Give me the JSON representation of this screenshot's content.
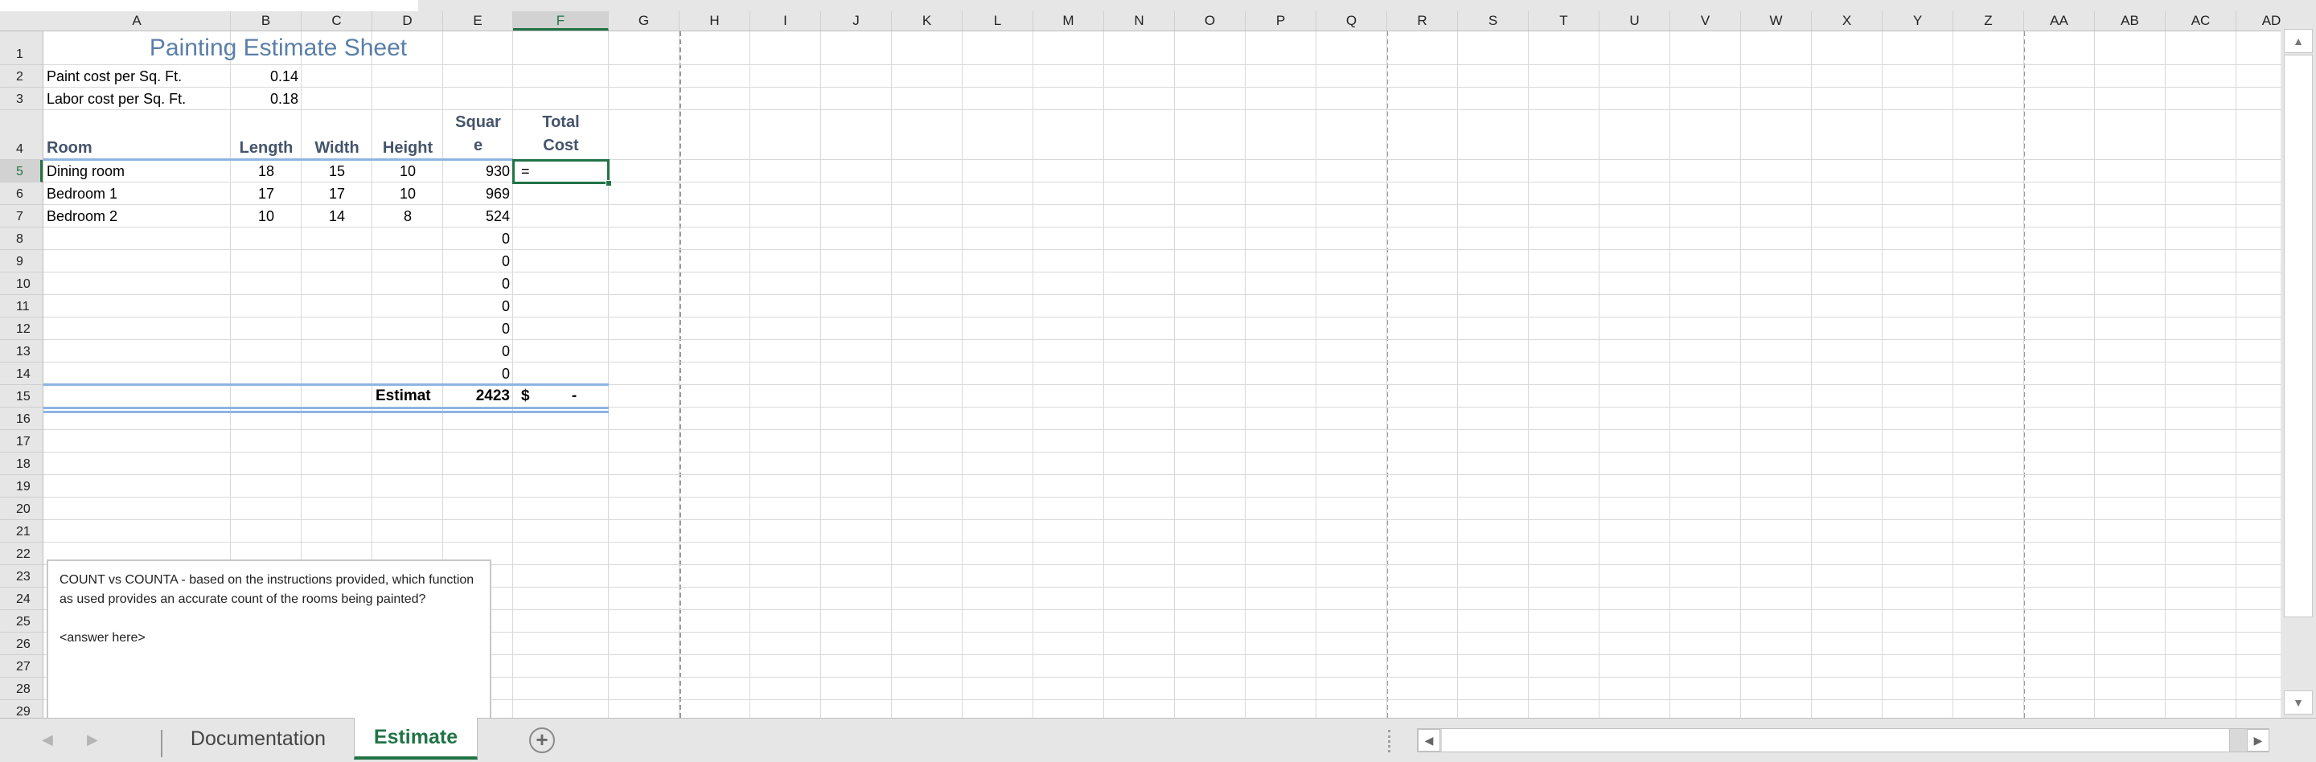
{
  "sheet": {
    "columns": [
      "A",
      "B",
      "C",
      "D",
      "E",
      "F",
      "G",
      "H",
      "I",
      "J",
      "K",
      "L",
      "M",
      "N",
      "O",
      "P",
      "Q",
      "R",
      "S",
      "T",
      "U",
      "V",
      "W",
      "X",
      "Y",
      "Z",
      "AA",
      "AB",
      "AC",
      "AD"
    ],
    "selected_column": "F",
    "rows": [
      "1",
      "2",
      "3",
      "4",
      "5",
      "6",
      "7",
      "8",
      "9",
      "10",
      "11",
      "12",
      "13",
      "14",
      "15",
      "16",
      "17",
      "18",
      "19",
      "20",
      "21",
      "22",
      "23",
      "24",
      "25",
      "26",
      "27",
      "28",
      "29"
    ],
    "selected_row": "5",
    "selected_cell": "F5",
    "title": "Painting Estimate Sheet",
    "paint_cost_label": "Paint cost per Sq. Ft.",
    "paint_cost_value": "0.14",
    "labor_cost_label": "Labor cost per Sq. Ft.",
    "labor_cost_value": "0.18",
    "headers": {
      "room": "Room",
      "length": "Length",
      "width": "Width",
      "height": "Height",
      "square_line1": "Squar",
      "square_line2": "e",
      "total_line1": "Total",
      "total_line2": "Cost"
    },
    "data_rows": [
      {
        "room": "Dining room",
        "length": "18",
        "width": "15",
        "height": "10",
        "square": "930",
        "total": "="
      },
      {
        "room": "Bedroom 1",
        "length": "17",
        "width": "17",
        "height": "10",
        "square": "969",
        "total": ""
      },
      {
        "room": "Bedroom 2",
        "length": "10",
        "width": "14",
        "height": "8",
        "square": "524",
        "total": ""
      },
      {
        "room": "",
        "length": "",
        "width": "",
        "height": "",
        "square": "0",
        "total": ""
      },
      {
        "room": "",
        "length": "",
        "width": "",
        "height": "",
        "square": "0",
        "total": ""
      },
      {
        "room": "",
        "length": "",
        "width": "",
        "height": "",
        "square": "0",
        "total": ""
      },
      {
        "room": "",
        "length": "",
        "width": "",
        "height": "",
        "square": "0",
        "total": ""
      },
      {
        "room": "",
        "length": "",
        "width": "",
        "height": "",
        "square": "0",
        "total": ""
      },
      {
        "room": "",
        "length": "",
        "width": "",
        "height": "",
        "square": "0",
        "total": ""
      },
      {
        "room": "",
        "length": "",
        "width": "",
        "height": "",
        "square": "0",
        "total": ""
      }
    ],
    "totals": {
      "label": "Estimat",
      "square_total": "2423",
      "currency_symbol": "$",
      "cost_total": "-"
    }
  },
  "textbox": {
    "question": "COUNT vs COUNTA - based on the instructions provided, which function as used provides an accurate count of the rooms being painted?",
    "answer": "<answer here>"
  },
  "tabs": {
    "items": [
      {
        "label": "Documentation",
        "active": false
      },
      {
        "label": "Estimate",
        "active": true
      }
    ],
    "add_sheet_icon": "+",
    "prev_icon": "◀",
    "next_icon": "▶"
  },
  "scrollbars": {
    "up_icon": "▲",
    "down_icon": "▼",
    "left_icon": "◀",
    "right_icon": "▶"
  },
  "colors": {
    "accent": "#217346",
    "title": "#5a7fa8",
    "header_text": "#44546a",
    "table_border": "#8eb4e3"
  }
}
